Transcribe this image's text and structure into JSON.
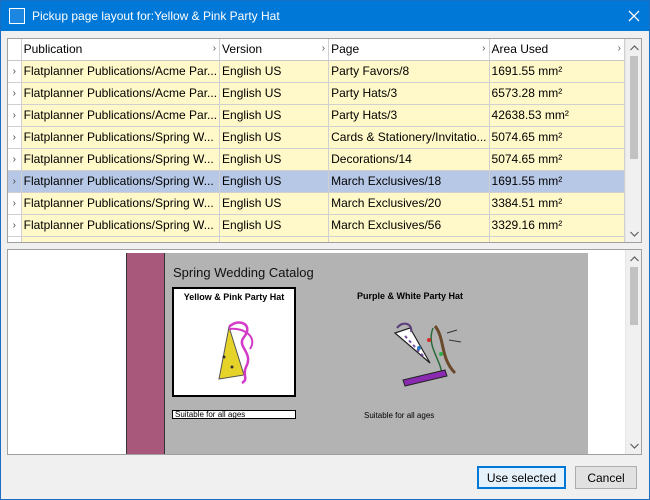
{
  "window": {
    "title": "Pickup page layout for:Yellow & Pink Party Hat"
  },
  "grid": {
    "columns": [
      "Publication",
      "Version",
      "Page",
      "Area Used"
    ],
    "rows": [
      {
        "publication": "Flatplanner Publications/Acme Par...",
        "version": "English US",
        "page": "Party Favors/8",
        "area": "1691.55 mm²",
        "selected": false
      },
      {
        "publication": "Flatplanner Publications/Acme Par...",
        "version": "English US",
        "page": "Party Hats/3",
        "area": "6573.28 mm²",
        "selected": false
      },
      {
        "publication": "Flatplanner Publications/Acme Par...",
        "version": "English US",
        "page": "Party Hats/3",
        "area": "42638.53 mm²",
        "selected": false
      },
      {
        "publication": "Flatplanner Publications/Spring W...",
        "version": "English US",
        "page": "Cards & Stationery/Invitatio...",
        "area": "5074.65 mm²",
        "selected": false
      },
      {
        "publication": "Flatplanner Publications/Spring W...",
        "version": "English US",
        "page": "Decorations/14",
        "area": "5074.65 mm²",
        "selected": false
      },
      {
        "publication": "Flatplanner Publications/Spring W...",
        "version": "English US",
        "page": "March Exclusives/18",
        "area": "1691.55 mm²",
        "selected": true
      },
      {
        "publication": "Flatplanner Publications/Spring W...",
        "version": "English US",
        "page": "March Exclusives/20",
        "area": "3384.51 mm²",
        "selected": false
      },
      {
        "publication": "Flatplanner Publications/Spring W...",
        "version": "English US",
        "page": "March Exclusives/56",
        "area": "3329.16 mm²",
        "selected": false
      }
    ],
    "row_color": "#fff8c8",
    "selected_row_color": "#b6c8e6"
  },
  "preview": {
    "page_title": "Spring Wedding Catalog",
    "product1_name": "Yellow & Pink Party Hat",
    "product2_name": "Purple & White Party Hat",
    "product1_desc": "Suitable for all ages",
    "product2_desc": "Suitable for all ages",
    "band_color": "#a8587a"
  },
  "buttons": {
    "use_selected": "Use selected",
    "cancel": "Cancel"
  },
  "icons": {
    "close": "close-icon",
    "row_indicator": "chevron-right-icon",
    "scroll_up": "chevron-up-icon",
    "scroll_down": "chevron-down-icon"
  }
}
